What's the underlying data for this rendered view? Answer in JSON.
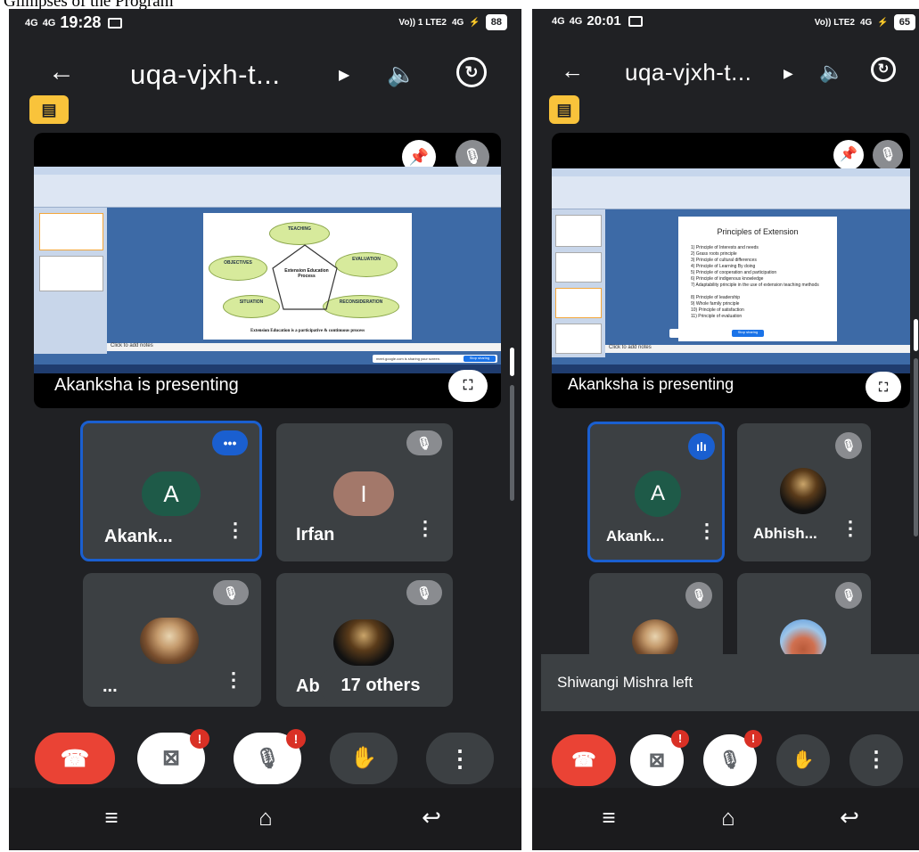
{
  "caption": "Glimpses of the Program",
  "screens": [
    {
      "status": {
        "network_left": "4G",
        "network_right": "4G",
        "time": "19:28",
        "volte": "Vo)) 1 LTE2",
        "net4g": "4G",
        "battery": "88"
      },
      "meeting_title": "uqa-vjxh-t...",
      "presenting_text": "Akanksha is presenting",
      "slide": {
        "center": "Extension Education Process",
        "clouds": [
          "TEACHING",
          "OBJECTIVES",
          "EVALUATION",
          "SITUATION",
          "RECONSIDERATION"
        ],
        "footer": "Extension Education is a participative & continuous process",
        "notes": "Click to add notes",
        "share_text": "meet.google.com is sharing your screen.",
        "share_button": "Stop sharing"
      },
      "tiles": [
        {
          "name": "Akank...",
          "initial": "A",
          "color": "#1e5a48"
        },
        {
          "name": "Irfan",
          "initial": "I",
          "color": "#a3786a"
        },
        {
          "name": "..."
        },
        {
          "name": "Ab"
        }
      ],
      "others": "17 others"
    },
    {
      "status": {
        "network_left": "4G",
        "network_right": "4G",
        "time": "20:01",
        "volte": "Vo)) LTE2",
        "net4g": "4G",
        "battery": "65"
      },
      "meeting_title": "uqa-vjxh-t...",
      "presenting_text": "Akanksha is presenting",
      "slide": {
        "title": "Principles of Extension",
        "items": [
          "1) Principle of Interests and needs",
          "2) Grass roots principle",
          "3) Principle of cultural differences",
          "4) Principle of Learning By doing",
          "5) Principle of cooperation and participation",
          "6) Principle of indigenous knowledge",
          "7) Adaptability principle in the use of extension teaching methods",
          "8) Principle of leadership",
          "9) Whole family principle",
          "10) Principle of satisfaction",
          "11) Principle of evaluation"
        ],
        "notes": "Click to add notes",
        "share_button": "Stop sharing"
      },
      "tiles": [
        {
          "name": "Akank...",
          "initial": "A",
          "color": "#1e5a48"
        },
        {
          "name": "Abhish..."
        },
        {
          "name": ""
        },
        {
          "name": ""
        }
      ],
      "toast": "Shiwangi Mishra left"
    }
  ]
}
